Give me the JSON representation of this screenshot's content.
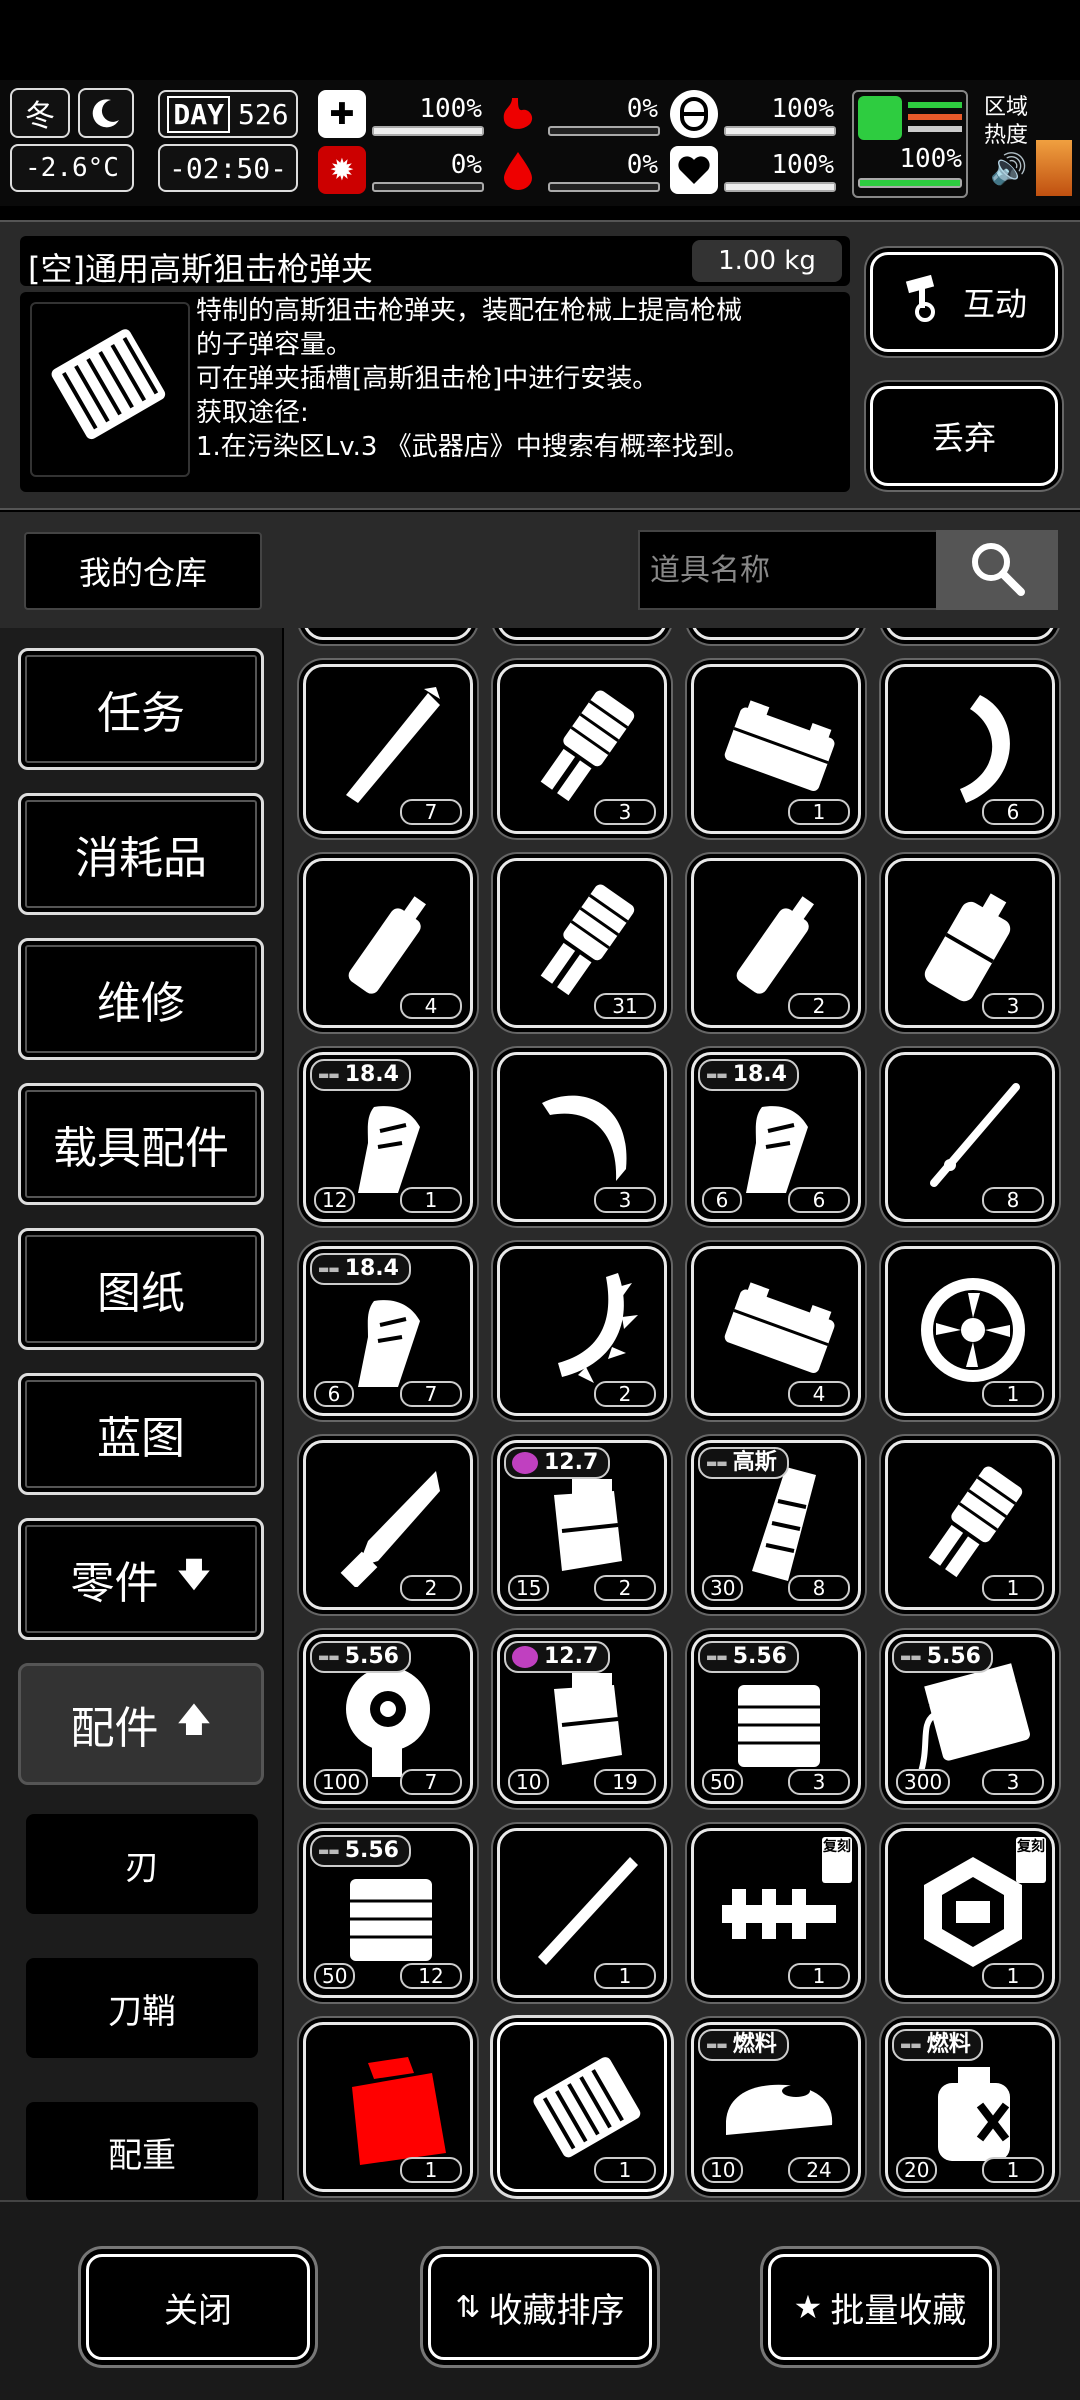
{
  "status": {
    "season": "冬",
    "temperature": "-2.6°C",
    "day_label": "DAY",
    "day_number": "526",
    "time": "-02:50-",
    "zone_heat_label": "区域热度",
    "meters": [
      {
        "icon": "medkit-icon",
        "value": "100%",
        "fill": 1.0
      },
      {
        "icon": "stomach-icon",
        "value": "0%",
        "fill": 0.0
      },
      {
        "icon": "bladder-icon",
        "value": "100%",
        "fill": 1.0
      },
      {
        "icon": "virus-icon",
        "value": "0%",
        "fill": 0.0
      },
      {
        "icon": "blood-drop-icon",
        "value": "0%",
        "fill": 0.0
      },
      {
        "icon": "heart-icon",
        "value": "100%",
        "fill": 1.0
      }
    ],
    "stamina": {
      "value": "100%",
      "fill": 1.0,
      "color": "#2ecc40"
    }
  },
  "item": {
    "name": "[空]通用高斯狙击枪弹夹",
    "weight": "1.00 kg",
    "description_lines": [
      "特制的高斯狙击枪弹夹，装配在枪械上提高枪械",
      "的子弹容量。",
      "可在弹夹插槽[高斯狙击枪]中进行安装。",
      "获取途径:",
      "1.在污染区Lv.3 《武器店》中搜索有概率找到。"
    ],
    "interact_label": "互动",
    "discard_label": "丢弃"
  },
  "toolbar": {
    "warehouse_label": "我的仓库",
    "search_placeholder": "道具名称"
  },
  "categories": [
    {
      "label": "任务"
    },
    {
      "label": "消耗品"
    },
    {
      "label": "维修"
    },
    {
      "label": "载具配件"
    },
    {
      "label": "图纸"
    },
    {
      "label": "蓝图"
    },
    {
      "label": "零件",
      "arrow": "🡇"
    },
    {
      "label": "配件",
      "arrow": "🡅",
      "active": true
    }
  ],
  "subcategories": [
    {
      "label": "刃"
    },
    {
      "label": "刀鞘"
    },
    {
      "label": "配重"
    }
  ],
  "items": [
    {
      "icon": "blade-icon",
      "count": "7"
    },
    {
      "icon": "suppressor-icon",
      "count": "3"
    },
    {
      "icon": "battery-pack-icon",
      "count": "1"
    },
    {
      "icon": "curved-saw-blade-icon",
      "count": "6"
    },
    {
      "icon": "spray-canister-icon",
      "count": "4"
    },
    {
      "icon": "suppressor-icon",
      "count": "31"
    },
    {
      "icon": "spray-canister-icon",
      "count": "2"
    },
    {
      "icon": "gas-canister-icon",
      "count": "3"
    },
    {
      "icon": "curved-magazine-icon",
      "count": "1",
      "left_count": "12",
      "tag": "18.4"
    },
    {
      "icon": "hook-blade-icon",
      "count": "3"
    },
    {
      "icon": "curved-magazine-icon",
      "count": "6",
      "left_count": "6",
      "tag": "18.4"
    },
    {
      "icon": "rod-icon",
      "count": "8"
    },
    {
      "icon": "curved-magazine-icon",
      "count": "7",
      "left_count": "6",
      "tag": "18.4"
    },
    {
      "icon": "spiked-saw-blade-icon",
      "count": "2"
    },
    {
      "icon": "battery-pack-icon",
      "count": "4"
    },
    {
      "icon": "fan-icon",
      "count": "1"
    },
    {
      "icon": "knife-blade-icon",
      "count": "2"
    },
    {
      "icon": "energy-magazine-icon",
      "count": "2",
      "left_count": "15",
      "tag": "12.7",
      "tag_color": "#c040c0"
    },
    {
      "icon": "gauss-magazine-icon",
      "count": "8",
      "left_count": "30",
      "tag": "高斯"
    },
    {
      "icon": "suppressor-icon",
      "count": "1"
    },
    {
      "icon": "drum-magazine-icon",
      "count": "7",
      "left_count": "100",
      "tag": "5.56"
    },
    {
      "icon": "energy-magazine-icon",
      "count": "19",
      "left_count": "10",
      "tag": "12.7",
      "tag_color": "#c040c0"
    },
    {
      "icon": "box-magazine-icon",
      "count": "3",
      "left_count": "50",
      "tag": "5.56"
    },
    {
      "icon": "ammo-box-icon",
      "count": "3",
      "left_count": "300",
      "tag": "5.56"
    },
    {
      "icon": "box-magazine-icon",
      "count": "12",
      "left_count": "50",
      "tag": "5.56"
    },
    {
      "icon": "katana-blade-icon",
      "count": "1"
    },
    {
      "icon": "rail-mount-icon",
      "count": "1",
      "corner": "复刻"
    },
    {
      "icon": "hex-weight-icon",
      "count": "1",
      "corner": "复刻"
    },
    {
      "icon": "red-weight-icon",
      "count": "1",
      "color": "#ff0000"
    },
    {
      "icon": "gauss-clip-icon",
      "count": "1",
      "selected": true
    },
    {
      "icon": "fuel-tank-icon",
      "count": "24",
      "left_count": "10",
      "tag": "燃料"
    },
    {
      "icon": "fuel-can-icon",
      "count": "1",
      "left_count": "20",
      "tag": "燃料"
    }
  ],
  "footer": {
    "close_label": "关闭",
    "sort_label": "收藏排序",
    "batch_fav_label": "批量收藏"
  }
}
